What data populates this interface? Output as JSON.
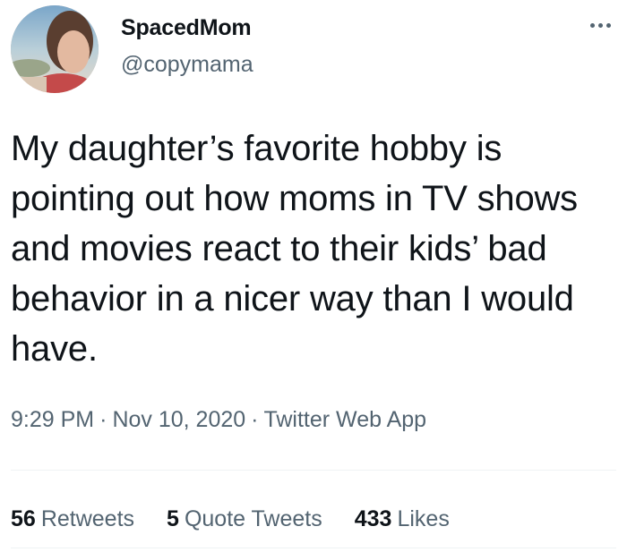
{
  "author": {
    "display_name": "SpacedMom",
    "handle": "@copymama"
  },
  "tweet": {
    "text": "My daughter’s favorite hobby is pointing out how moms in TV shows and movies react to their kids’ bad behavior in a nicer way than I would have.",
    "time": "9:29 PM",
    "date": "Nov 10, 2020",
    "source": "Twitter Web App",
    "separator": "·"
  },
  "stats": {
    "retweets_count": "56",
    "retweets_label": "Retweets",
    "quotes_count": "5",
    "quotes_label": "Quote Tweets",
    "likes_count": "433",
    "likes_label": "Likes"
  },
  "icons": {
    "more": "more-horizontal-icon"
  }
}
